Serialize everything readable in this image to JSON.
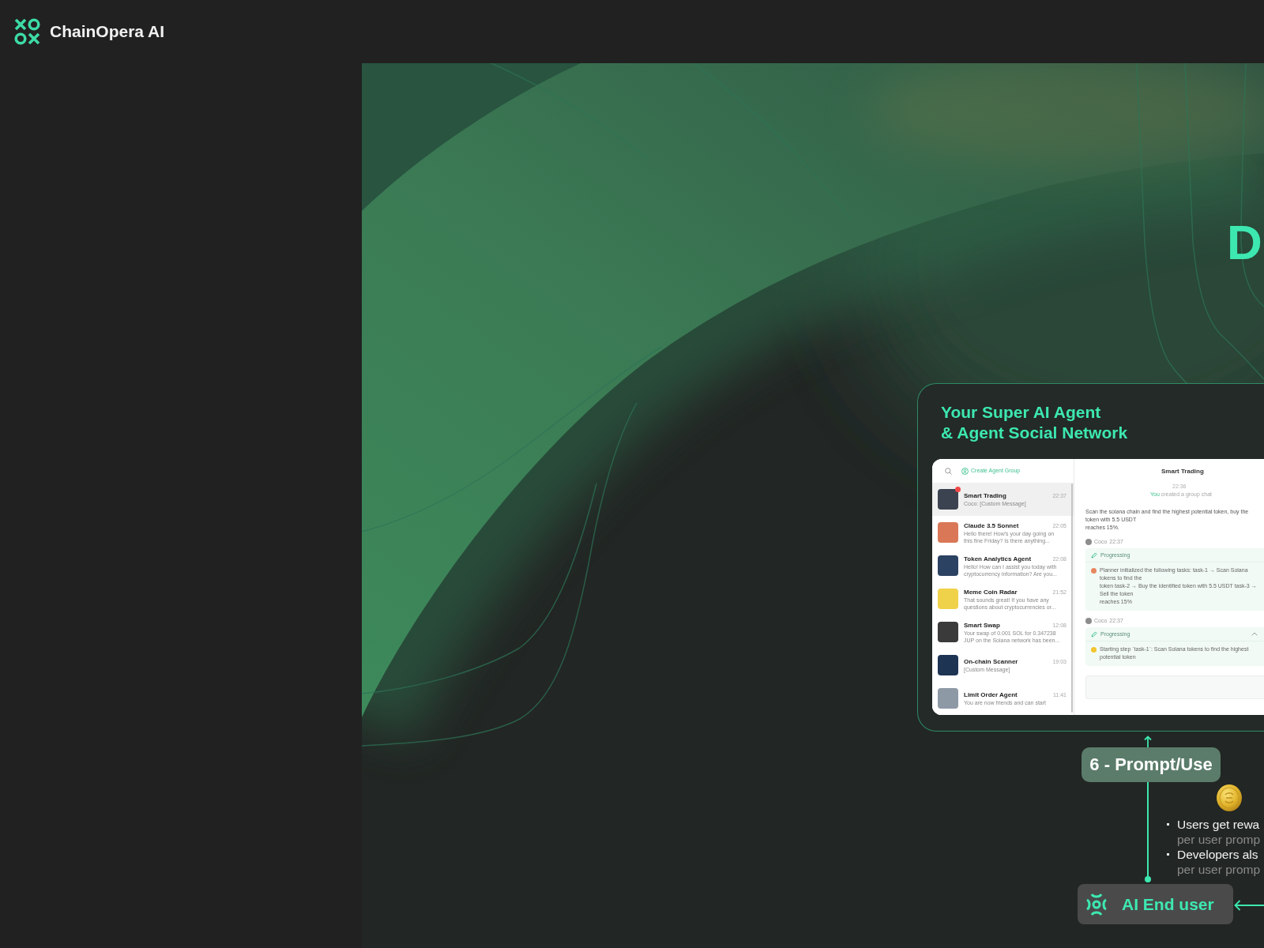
{
  "header": {
    "brand": "ChainOpera AI"
  },
  "hero": {
    "title": "D"
  },
  "agent_card": {
    "title_lines": [
      "Your Super AI Agent",
      "& Agent Social Network"
    ],
    "app": {
      "sidebar": {
        "action": "Create Agent Group",
        "chats": [
          {
            "name": "Smart Trading",
            "time": "22:37",
            "preview_lines": [
              "Coco: [Custom Message]"
            ],
            "color": "#3c4350",
            "selected": true,
            "unread": true
          },
          {
            "name": "Claude 3.5 Sonnet",
            "time": "22:05",
            "preview_lines": [
              "Hello there! How's your day going on",
              "this fine Friday? Is there anything..."
            ],
            "color": "#d97757",
            "selected": false,
            "unread": false
          },
          {
            "name": "Token Analytics Agent",
            "time": "22:08",
            "preview_lines": [
              "Hello! How can I assist you today with",
              "cryptocurrency information? Are you..."
            ],
            "color": "#2c4263",
            "selected": false,
            "unread": false
          },
          {
            "name": "Meme Coin Radar",
            "time": "21:52",
            "preview_lines": [
              "That sounds great! If you have any",
              "questions about cryptocurrencies or..."
            ],
            "color": "#f0d24a",
            "selected": false,
            "unread": false
          },
          {
            "name": "Smart Swap",
            "time": "12:08",
            "preview_lines": [
              "Your swap of 0.001 SOL for 0.347238",
              "JUP on the Solana network has been..."
            ],
            "color": "#3a3a3a",
            "selected": false,
            "unread": false
          },
          {
            "name": "On-chain Scanner",
            "time": "19:03",
            "preview_lines": [
              "[Custom Message]"
            ],
            "color": "#1d3452",
            "selected": false,
            "unread": false
          },
          {
            "name": "Limit Order Agent",
            "time": "11:41",
            "preview_lines": [
              "You are now friends and can start"
            ],
            "color": "#8e99a6",
            "selected": false,
            "unread": false
          }
        ]
      },
      "chat": {
        "title": "Smart Trading",
        "time": "22:36",
        "note": {
          "actor": "You",
          "text": "created a group chat"
        },
        "messages": [
          {
            "kind": "prompt",
            "lines": [
              "Scan the solana chain and find the highest potential token, buy the token with 5.5 USDT",
              "reaches 15%."
            ]
          },
          {
            "kind": "task",
            "sender": "Coco",
            "time": "22:37",
            "status": "Progressing",
            "color": "#e8875f",
            "lines": [
              "Planner initialized the following tasks: task-1 → Scan Solana tokens to find the",
              "token task-2 → Buy the identified token with 5.5 USDT task-3 → Sell the token",
              "reaches 15%"
            ]
          },
          {
            "kind": "task",
            "sender": "Coco",
            "time": "22:37",
            "status": "Progressing",
            "expanded": true,
            "color": "#f2c530",
            "lines": [
              "Starting step `task-1`: Scan Solana tokens to find the highest potential token"
            ]
          }
        ]
      }
    }
  },
  "step": {
    "label": "6 - Prompt/Use"
  },
  "rewards": [
    {
      "title": "Users get rewa",
      "detail": "per user promp"
    },
    {
      "title": "Developers als",
      "detail": "per user promp"
    }
  ],
  "end_user": {
    "label": "AI End user"
  }
}
